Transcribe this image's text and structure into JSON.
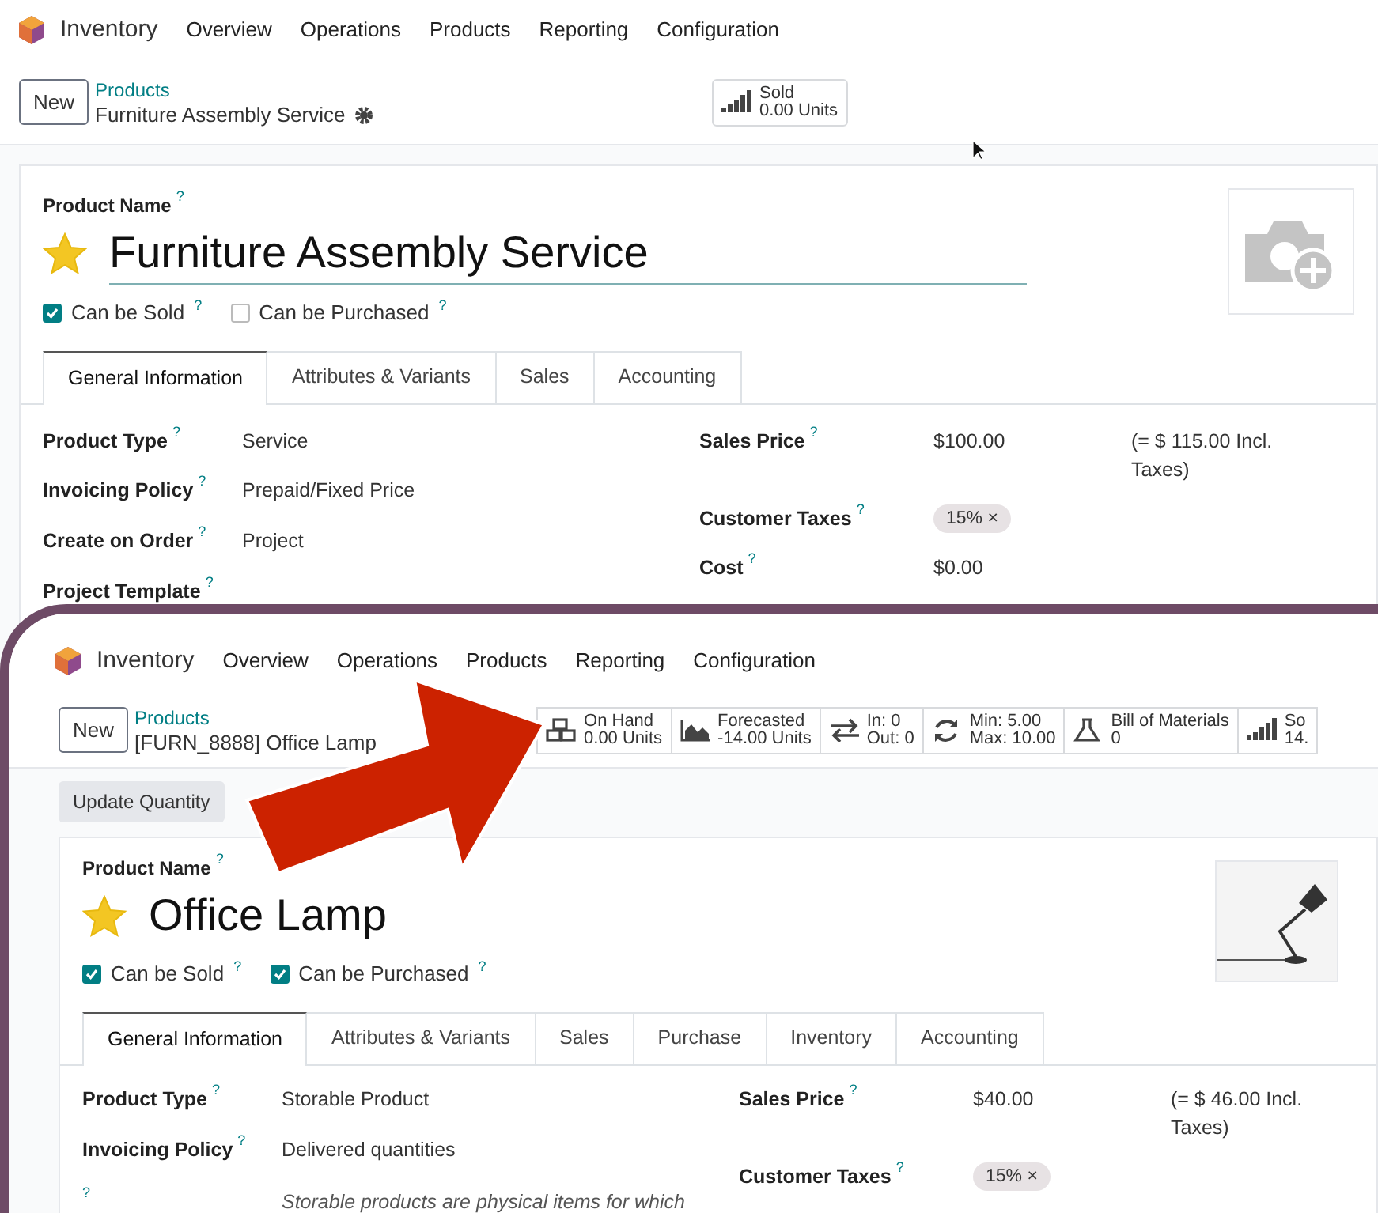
{
  "screens": [
    {
      "app": "Inventory",
      "menu": [
        "Overview",
        "Operations",
        "Products",
        "Reporting",
        "Configuration"
      ],
      "new_button": "New",
      "breadcrumb": "Products",
      "record": "Furniture Assembly Service",
      "gear": true,
      "smart_buttons": [
        {
          "kind": "bars",
          "line1": "Sold",
          "line2": "0.00 Units"
        }
      ],
      "name_label": "Product Name",
      "help": "?",
      "starred": true,
      "product_name": "Furniture Assembly Service",
      "image": {
        "kind": "placeholder"
      },
      "checkboxes": [
        {
          "label": "Can be Sold",
          "checked": true
        },
        {
          "label": "Can be Purchased",
          "checked": false
        }
      ],
      "tabs": [
        {
          "label": "General Information",
          "selected": true
        },
        {
          "label": "Attributes & Variants",
          "selected": false
        },
        {
          "label": "Sales",
          "selected": false
        },
        {
          "label": "Accounting",
          "selected": false
        }
      ],
      "left_fields": [
        {
          "label": "Product Type",
          "value": "Service"
        },
        {
          "label": "Invoicing Policy",
          "value": "Prepaid/Fixed Price"
        },
        {
          "label": "Create on Order",
          "value": "Project"
        },
        {
          "label": "Project Template"
        }
      ],
      "right_fields": [
        {
          "label": "Sales Price",
          "value": "$100.00",
          "note": "(= $ 115.00 Incl. Taxes)"
        },
        {
          "label": "Customer Taxes",
          "tag": "15% ×"
        },
        {
          "label": "Cost",
          "value": "$0.00"
        }
      ]
    },
    {
      "app": "Inventory",
      "menu": [
        "Overview",
        "Operations",
        "Products",
        "Reporting",
        "Configuration"
      ],
      "new_button": "New",
      "breadcrumb": "Products",
      "record": "[FURN_8888] Office Lamp",
      "smart_buttons": [
        {
          "kind": "cubes",
          "line1": "On Hand",
          "line2": "0.00 Units"
        },
        {
          "kind": "area",
          "line1": "Forecasted",
          "line2": "-14.00 Units"
        },
        {
          "kind": "arrows",
          "line1": "In: 0",
          "line2": "Out: 0"
        },
        {
          "kind": "refresh",
          "line1": "Min: 5.00",
          "line2": "Max: 10.00"
        },
        {
          "kind": "flask",
          "line1": "Bill of Materials",
          "line2": "0"
        },
        {
          "kind": "bars",
          "line1": "So",
          "line2": "14."
        }
      ],
      "action_buttons": [
        "Update Quantity"
      ],
      "name_label": "Product Name",
      "help": "?",
      "starred": true,
      "product_name": "Office Lamp",
      "image": {
        "kind": "picture"
      },
      "checkboxes": [
        {
          "label": "Can be Sold",
          "checked": true
        },
        {
          "label": "Can be Purchased",
          "checked": true
        }
      ],
      "tabs": [
        {
          "label": "General Information",
          "selected": true
        },
        {
          "label": "Attributes & Variants",
          "selected": false
        },
        {
          "label": "Sales",
          "selected": false
        },
        {
          "label": "Purchase",
          "selected": false
        },
        {
          "label": "Inventory",
          "selected": false
        },
        {
          "label": "Accounting",
          "selected": false
        }
      ],
      "left_fields": [
        {
          "label": "Product Type",
          "value": "Storable Product"
        },
        {
          "label": "Invoicing Policy",
          "value": "Delivered quantities"
        },
        {
          "description": "Storable products are physical items for which"
        }
      ],
      "right_fields": [
        {
          "label": "Sales Price",
          "value": "$40.00",
          "note": "(= $ 46.00 Incl. Taxes)"
        },
        {
          "label": "Customer Taxes",
          "tag": "15% ×"
        }
      ]
    }
  ]
}
